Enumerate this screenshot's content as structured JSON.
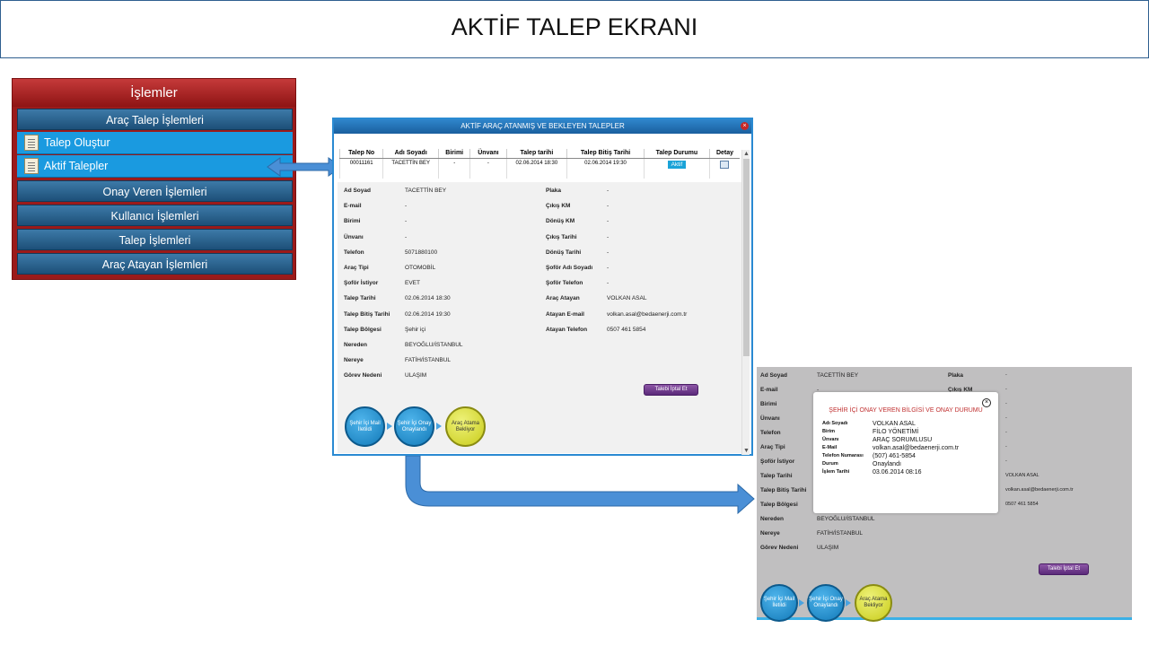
{
  "header": {
    "title": "AKTİF TALEP EKRANI"
  },
  "menu": {
    "title": "İşlemler",
    "sections": [
      {
        "label": "Araç Talep İşlemleri"
      },
      {
        "label": "Onay Veren İşlemleri"
      },
      {
        "label": "Kullanıcı İşlemleri"
      },
      {
        "label": "Talep İşlemleri"
      },
      {
        "label": "Araç Atayan İşlemleri"
      }
    ],
    "sub_items": [
      {
        "label": "Talep Oluştur",
        "icon": "form-icon"
      },
      {
        "label": "Aktif Talepler",
        "icon": "list-icon"
      }
    ]
  },
  "window": {
    "title": "AKTİF ARAÇ ATANMIŞ VE BEKLEYEN TALEPLER",
    "columns": [
      "Talep No",
      "Adı Soyadı",
      "Birimi",
      "Ünvanı",
      "Talep tarihi",
      "Talep Bitiş Tarihi",
      "Talep Durumu",
      "Detay"
    ],
    "row": {
      "no": "00011161",
      "name": "TACETTİN BEY",
      "birim": "-",
      "unvan": "-",
      "tarih": "02.06.2014 18:30",
      "bitis": "02.06.2014 19:30",
      "durum": "Aktif"
    }
  },
  "detail": {
    "left": [
      {
        "label": "Ad Soyad",
        "value": "TACETTİN BEY"
      },
      {
        "label": "E-mail",
        "value": "-"
      },
      {
        "label": "Birimi",
        "value": "-"
      },
      {
        "label": "Ünvanı",
        "value": "-"
      },
      {
        "label": "Telefon",
        "value": "5071880100"
      },
      {
        "label": "Araç Tipi",
        "value": "OTOMOBİL"
      },
      {
        "label": "Şoför İstiyor",
        "value": "EVET"
      },
      {
        "label": "Talep Tarihi",
        "value": "02.06.2014 18:30"
      },
      {
        "label": "Talep Bitiş Tarihi",
        "value": "02.06.2014 19:30"
      },
      {
        "label": "Talep Bölgesi",
        "value": "Şehir içi"
      },
      {
        "label": "Nereden",
        "value": "BEYOĞLU/İSTANBUL"
      },
      {
        "label": "Nereye",
        "value": "FATİH/İSTANBUL"
      },
      {
        "label": "Görev Nedeni",
        "value": "ULAŞIM"
      }
    ],
    "right": [
      {
        "label": "Plaka",
        "value": "-"
      },
      {
        "label": "Çıkış KM",
        "value": "-"
      },
      {
        "label": "Dönüş KM",
        "value": "-"
      },
      {
        "label": "Çıkış Tarihi",
        "value": "-"
      },
      {
        "label": "Dönüş Tarihi",
        "value": "-"
      },
      {
        "label": "Şoför Adı Soyadı",
        "value": "-"
      },
      {
        "label": "Şoför Telefon",
        "value": "-"
      },
      {
        "label": "Araç Atayan",
        "value": "VOLKAN ASAL"
      },
      {
        "label": "Atayan E-mail",
        "value": "volkan.asal@bedaenerji.com.tr"
      },
      {
        "label": "Atayan Telefon",
        "value": "0507 461 5854"
      }
    ],
    "cancel_label": "Talebi İptal Et",
    "steps": [
      "Şehir İçi Mail İletildi",
      "Şehir İçi Onay Onaylandı",
      "Araç Atama Bekliyor"
    ]
  },
  "panel2": {
    "left": [
      {
        "label": "Ad Soyad",
        "value": "TACETTİN BEY"
      },
      {
        "label": "E-mail",
        "value": "-"
      },
      {
        "label": "Birimi",
        "value": ""
      },
      {
        "label": "Ünvanı",
        "value": ""
      },
      {
        "label": "Telefon",
        "value": ""
      },
      {
        "label": "Araç Tipi",
        "value": ""
      },
      {
        "label": "Şoför İstiyor",
        "value": ""
      },
      {
        "label": "Talep Tarihi",
        "value": ""
      },
      {
        "label": "Talep Bitiş Tarihi",
        "value": ""
      },
      {
        "label": "Talep Bölgesi",
        "value": ""
      },
      {
        "label": "Nereden",
        "value": "BEYOĞLU/İSTANBUL"
      },
      {
        "label": "Nereye",
        "value": "FATİH/İSTANBUL"
      },
      {
        "label": "Görev Nedeni",
        "value": "ULAŞIM"
      }
    ],
    "right_labels": [
      "Plaka",
      "Çıkış KM"
    ],
    "right_values": [
      "-",
      "-",
      "-",
      "-",
      "-",
      "-",
      "-",
      "VOLKAN ASAL",
      "volkan.asal@bedaenerji.com.tr",
      "0507 461 5854"
    ],
    "cancel_label": "Talebi İptal Et",
    "steps": [
      "Şehir İçi Mail İletildi",
      "Şehir İçi Onay Onaylandı",
      "Araç Atama Bekliyor"
    ]
  },
  "modal": {
    "title": "ŞEHİR İÇİ ONAY VEREN BİLGİSİ VE ONAY DURUMU",
    "rows": [
      {
        "label": "Adı Soyadı",
        "value": "VOLKAN ASAL"
      },
      {
        "label": "Birim",
        "value": "FİLO YÖNETİMİ"
      },
      {
        "label": "Ünvanı",
        "value": "ARAÇ SORUMLUSU"
      },
      {
        "label": "E-Mail",
        "value": "volkan.asal@bedaenerji.com.tr"
      },
      {
        "label": "Telefon Numarası",
        "value": "(507) 461-5854"
      },
      {
        "label": "Durum",
        "value": "Onaylandı"
      },
      {
        "label": "İşlem Tarihi",
        "value": "03.06.2014 08:16"
      }
    ]
  },
  "colors": {
    "menu_red": "#9b1a1a",
    "menu_blue": "#1a9ae0",
    "accent": "#2a8ad2",
    "arrow": "#4a8fd6"
  }
}
